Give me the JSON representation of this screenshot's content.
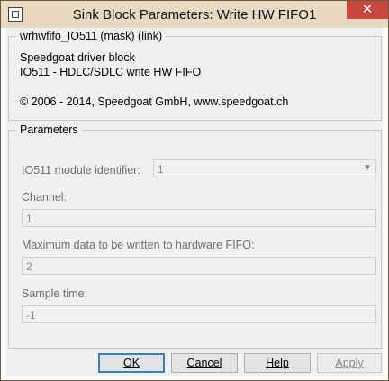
{
  "window": {
    "title": "Sink Block Parameters: Write HW FIFO1",
    "close_glyph": "✕"
  },
  "description": {
    "legend": "wrhwfifo_IO511 (mask) (link)",
    "line1": "Speedgoat driver block",
    "line2": "IO511 - HDLC/SDLC write HW FIFO",
    "line3": "© 2006 - 2014, Speedgoat GmbH, www.speedgoat.ch"
  },
  "parameters": {
    "legend": "Parameters",
    "module_id_label": "IO511 module identifier:",
    "module_id_value": "1",
    "channel_label": "Channel:",
    "channel_value": "1",
    "max_data_label": "Maximum data to be written to hardware FIFO:",
    "max_data_value": "2",
    "sample_time_label": "Sample time:",
    "sample_time_value": "-1"
  },
  "buttons": {
    "ok": "OK",
    "cancel": "Cancel",
    "help": "Help",
    "apply": "Apply"
  },
  "icons": {
    "app": "window-icon",
    "close": "close-icon",
    "dropdown": "chevron-down-icon"
  }
}
